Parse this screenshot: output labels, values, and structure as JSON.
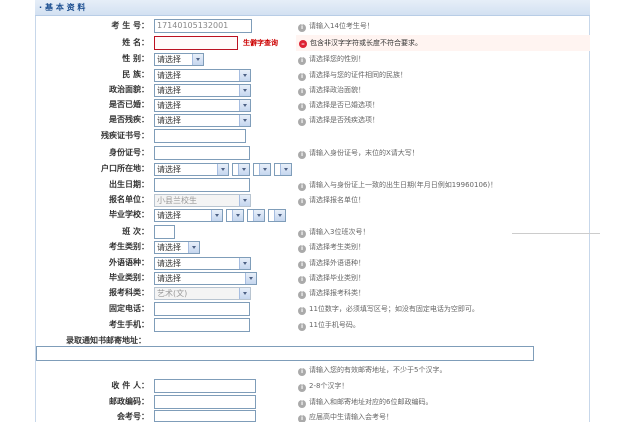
{
  "section": {
    "title": "基 本 资 料"
  },
  "rows": {
    "exam_no": {
      "label": "考 生 号：",
      "value": "17140105132001",
      "hint": "请输入14位考生号！"
    },
    "name": {
      "label": "姓 名：",
      "value": "",
      "error_label": "生僻字查询",
      "hint": "包含非汉字字符或长度不符合要求。"
    },
    "gender": {
      "label": "性 别：",
      "selected": "请选择",
      "hint": "请选择您的性别！"
    },
    "ethnicity": {
      "label": "民 族：",
      "selected": "请选择",
      "hint": "请选择与您的证件相同的民族！"
    },
    "politics": {
      "label": "政治面貌：",
      "selected": "请选择",
      "hint": "请选择政治面貌！"
    },
    "married": {
      "label": "是否已婚：",
      "selected": "请选择",
      "hint": "请选择是否已婚选项！"
    },
    "disabled": {
      "label": "是否残疾：",
      "selected": "请选择",
      "hint": "请选择是否残疾选项！"
    },
    "disability_cert": {
      "label": "残疾证书号：",
      "value": ""
    },
    "id_no": {
      "label": "身份证号：",
      "value": "",
      "hint": "请输入身份证号，末位的X请大写！"
    },
    "hukou": {
      "label": "户口所在地：",
      "selected": "请选择",
      "hint": ""
    },
    "birth": {
      "label": "出生日期：",
      "value": "",
      "hint": "请输入与身份证上一致的出生日期(年月日例如19960106)！"
    },
    "unit": {
      "label": "报名单位：",
      "selected": "小县兰校生",
      "hint": "请选择报名单位！"
    },
    "school": {
      "label": "毕业学校：",
      "selected": "请选择",
      "hint": ""
    },
    "class_no": {
      "label": "班 次：",
      "value": "",
      "hint": "请输入3位班次号！"
    },
    "category": {
      "label": "考生类别：",
      "selected": "请选择",
      "hint": "请选择考生类别！"
    },
    "language": {
      "label": "外语语种：",
      "selected": "请选择",
      "hint": "请选择外语语种！"
    },
    "grad_type": {
      "label": "毕业类别：",
      "selected": "请选择",
      "hint": "请选择毕业类别！"
    },
    "subject": {
      "label": "报考科类：",
      "selected": "艺术(文)",
      "hint": "请选择报考科类！"
    },
    "phone": {
      "label": "固定电话：",
      "value": "",
      "hint": "11位数字，必须填写区号；如没有固定电话为空即可。"
    },
    "mobile": {
      "label": "考生手机：",
      "value": "",
      "hint": "11位手机号码。"
    },
    "mail_addr": {
      "label": "录取通知书邮寄地址：",
      "value": "",
      "hint": "请输入您的有效邮寄地址，不少于5个汉字。"
    },
    "recipient": {
      "label": "收 件 人：",
      "value": "",
      "hint": "2-8个汉字！"
    },
    "postcode": {
      "label": "邮政编码：",
      "value": "",
      "hint": "请输入和邮寄地址对应的6位邮政编码。"
    },
    "hs_no": {
      "label": "会考号：",
      "value": "",
      "hint": "应届高中生请输入会考号！"
    }
  }
}
